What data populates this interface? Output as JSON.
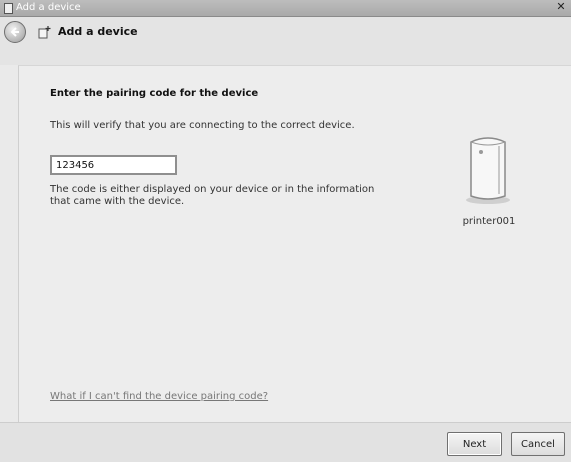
{
  "window": {
    "title": "Add a device",
    "close_glyph": "✕"
  },
  "nav": {
    "title": "Add a device",
    "back_icon": "back-arrow-icon"
  },
  "main": {
    "heading": "Enter the pairing code for the device",
    "description": "This will verify that you are connecting to the correct device.",
    "code_value": "123456",
    "hint": "The code is either displayed on your device or in the information that came with the device.",
    "device_name": "printer001",
    "device_icon": "printer-icon",
    "help_link": "What if I can't find the device pairing code?"
  },
  "footer": {
    "next_label": "Next",
    "cancel_label": "Cancel"
  }
}
